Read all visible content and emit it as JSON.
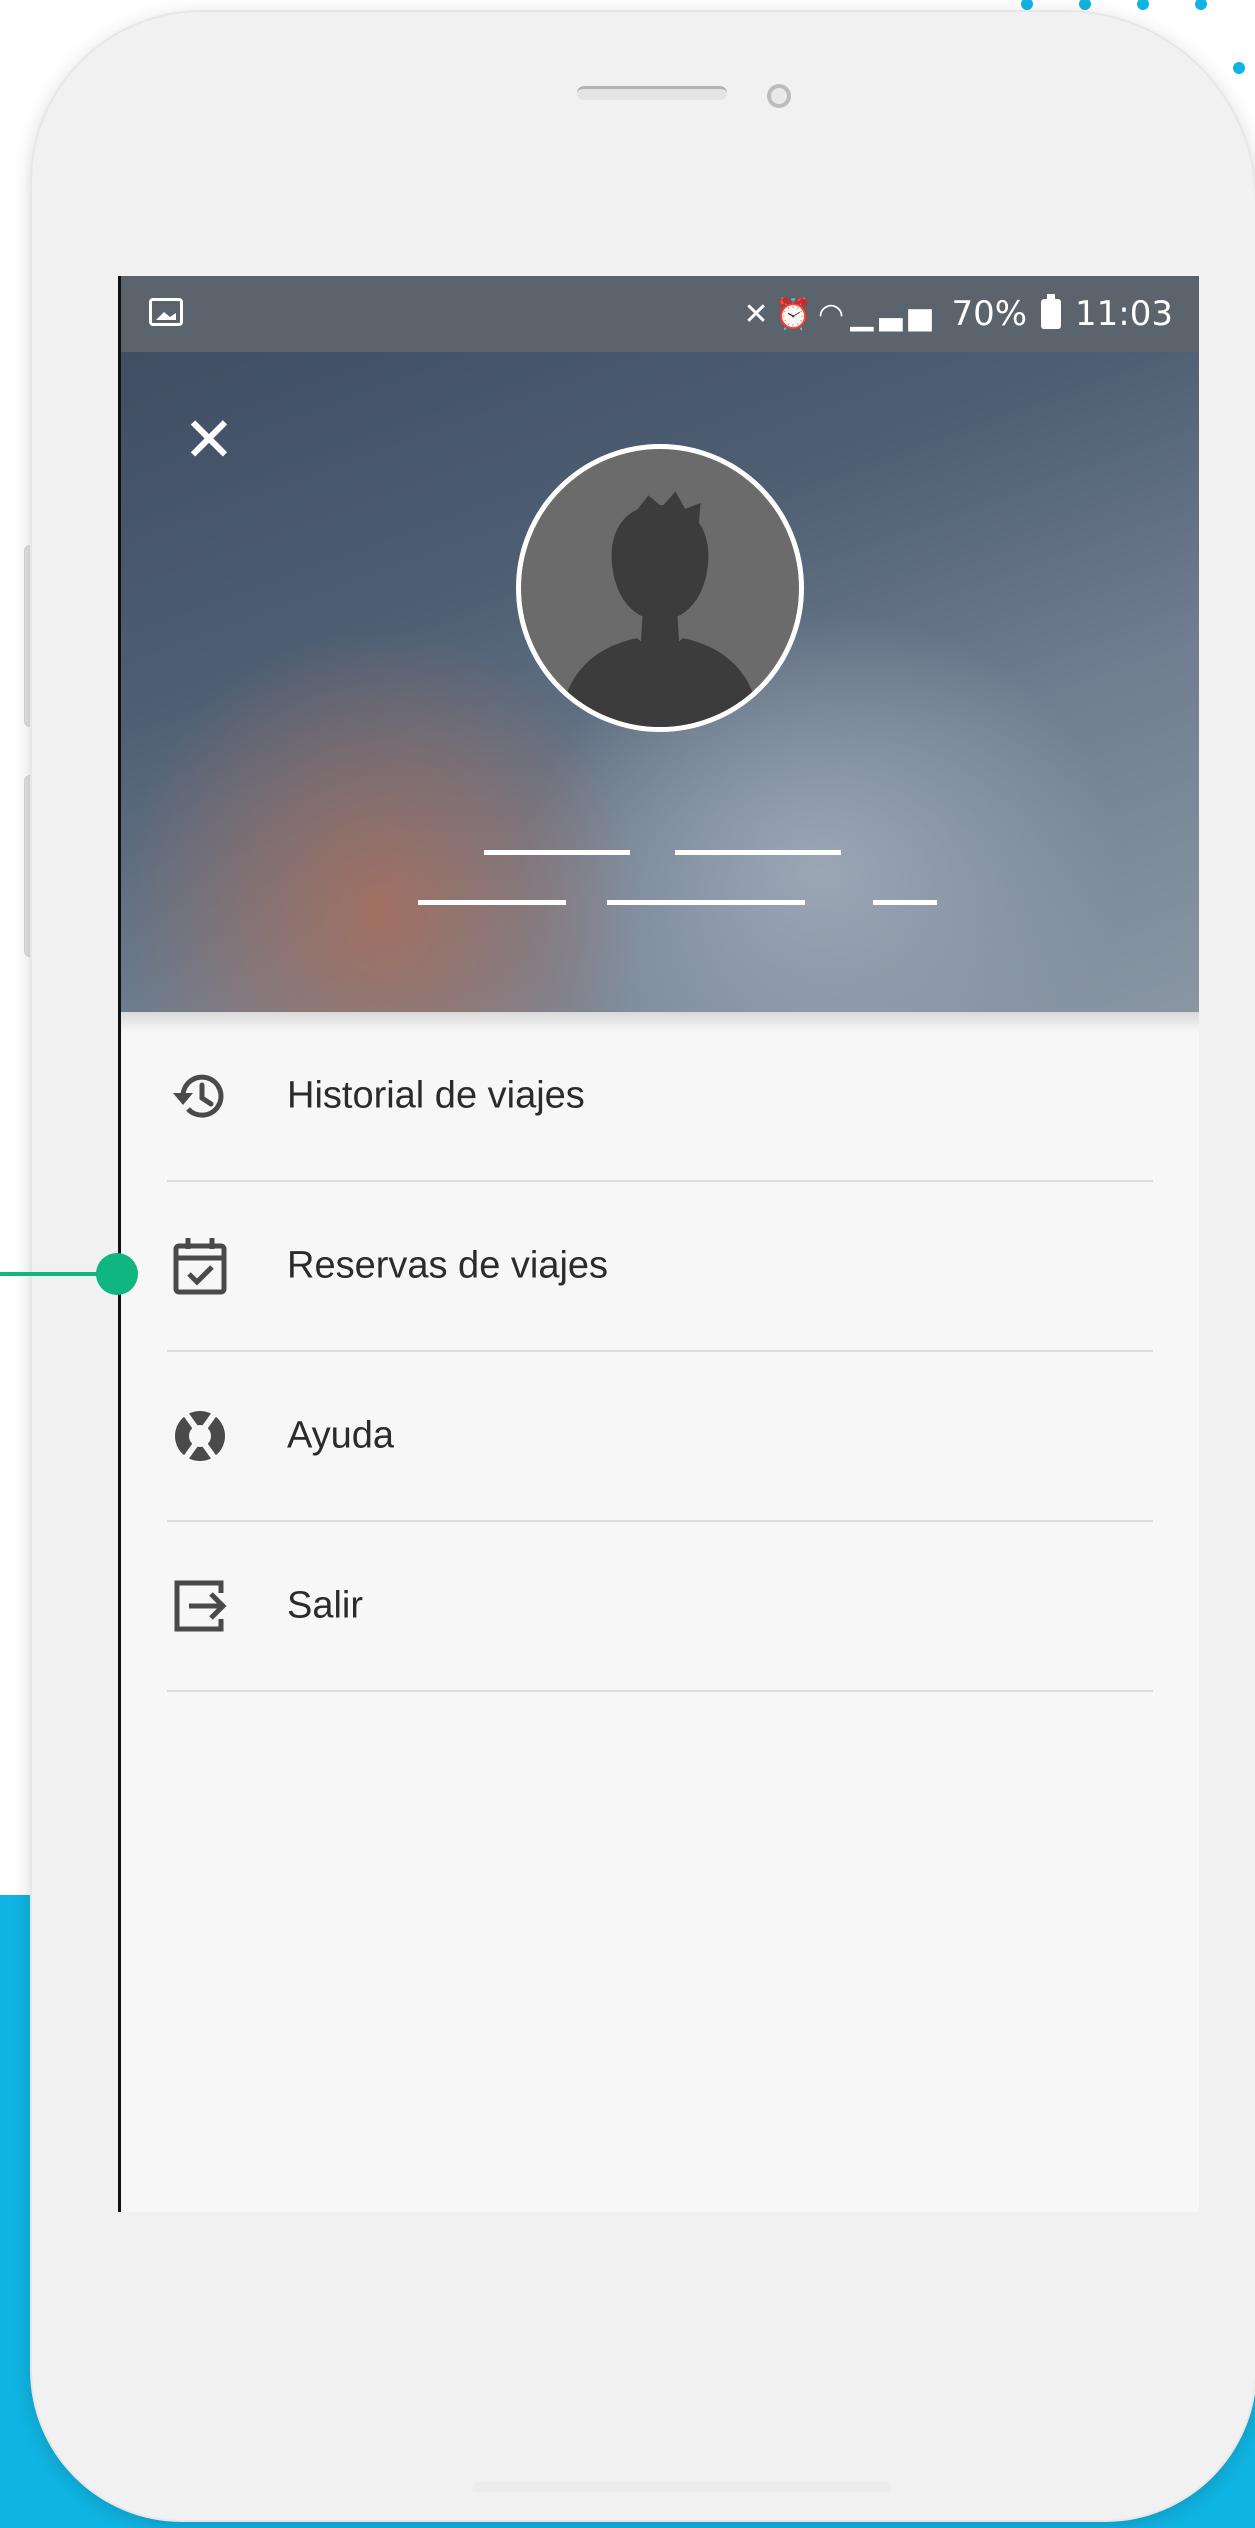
{
  "status_bar": {
    "battery": "70%",
    "time": "11:03",
    "left_icon": "image-icon",
    "right_icons": [
      "mute-icon",
      "alarm-icon",
      "wifi-icon",
      "signal-icon",
      "battery-icon"
    ]
  },
  "header": {
    "close_icon": "close-icon",
    "avatar_icon": "person-silhouette-icon"
  },
  "menu": {
    "items": [
      {
        "label": "Historial de viajes",
        "icon": "history-icon"
      },
      {
        "label": "Reservas de viajes",
        "icon": "calendar-check-icon"
      },
      {
        "label": "Ayuda",
        "icon": "lifebuoy-icon"
      },
      {
        "label": "Salir",
        "icon": "logout-icon"
      }
    ]
  },
  "colors": {
    "accent_blue": "#10b4e2",
    "connector_green": "#10b67f",
    "status_bar": "#5b636d"
  }
}
